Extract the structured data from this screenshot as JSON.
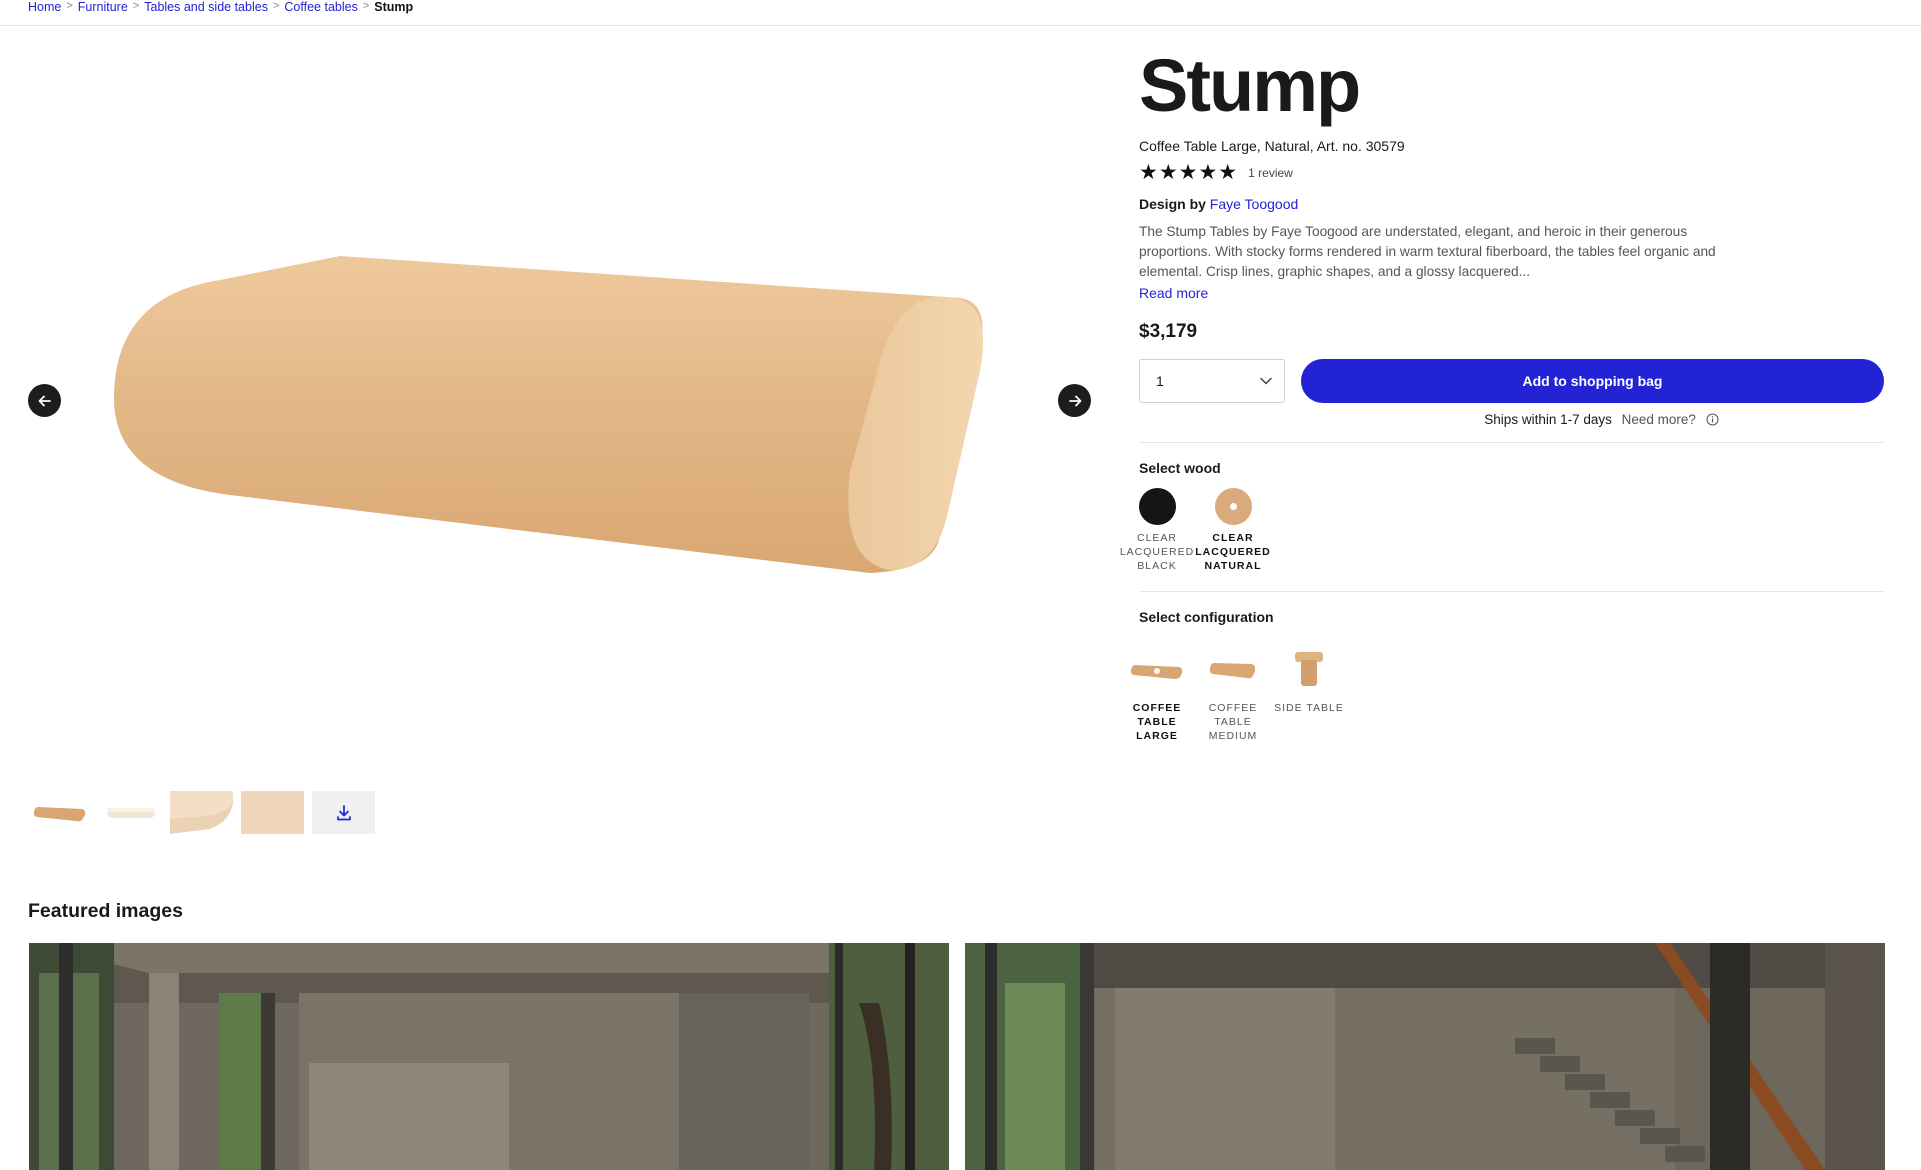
{
  "breadcrumb": {
    "items": [
      "Home",
      "Furniture",
      "Tables and side tables",
      "Coffee tables"
    ],
    "current": "Stump",
    "separator": ">"
  },
  "gallery": {
    "prev_icon": "arrow-left-icon",
    "next_icon": "arrow-right-icon",
    "download_icon": "download-icon"
  },
  "product": {
    "title": "Stump",
    "subtitle": "Coffee Table Large, Natural, Art. no. 30579",
    "stars": "★★★★★",
    "rating": 5,
    "review_count": "1 review",
    "design_by_label": "Design by",
    "designer": "Faye Toogood",
    "description": "The Stump Tables by Faye Toogood are understated, elegant, and heroic in their generous proportions. With stocky forms rendered in warm textural fiberboard, the tables feel organic and elemental. Crisp lines, graphic shapes, and a glossy lacquered...",
    "read_more": "Read more",
    "price": "$3,179",
    "quantity": "1",
    "add_to_bag": "Add to shopping bag",
    "ships": "Ships within 1-7 days",
    "need_more": "Need more?"
  },
  "wood": {
    "title": "Select wood",
    "options": [
      {
        "label": "Clear lacquered black",
        "color": "#151515",
        "selected": false
      },
      {
        "label": "Clear lacquered natural",
        "color": "#d9ab7c",
        "selected": true
      }
    ]
  },
  "configuration": {
    "title": "Select configuration",
    "options": [
      {
        "label": "Coffee table large",
        "selected": true
      },
      {
        "label": "Coffee table medium",
        "selected": false
      },
      {
        "label": "Side table",
        "selected": false
      }
    ]
  },
  "featured": {
    "title": "Featured images"
  },
  "colors": {
    "accent": "#2323d6",
    "wood_natural": "#e1b686"
  }
}
